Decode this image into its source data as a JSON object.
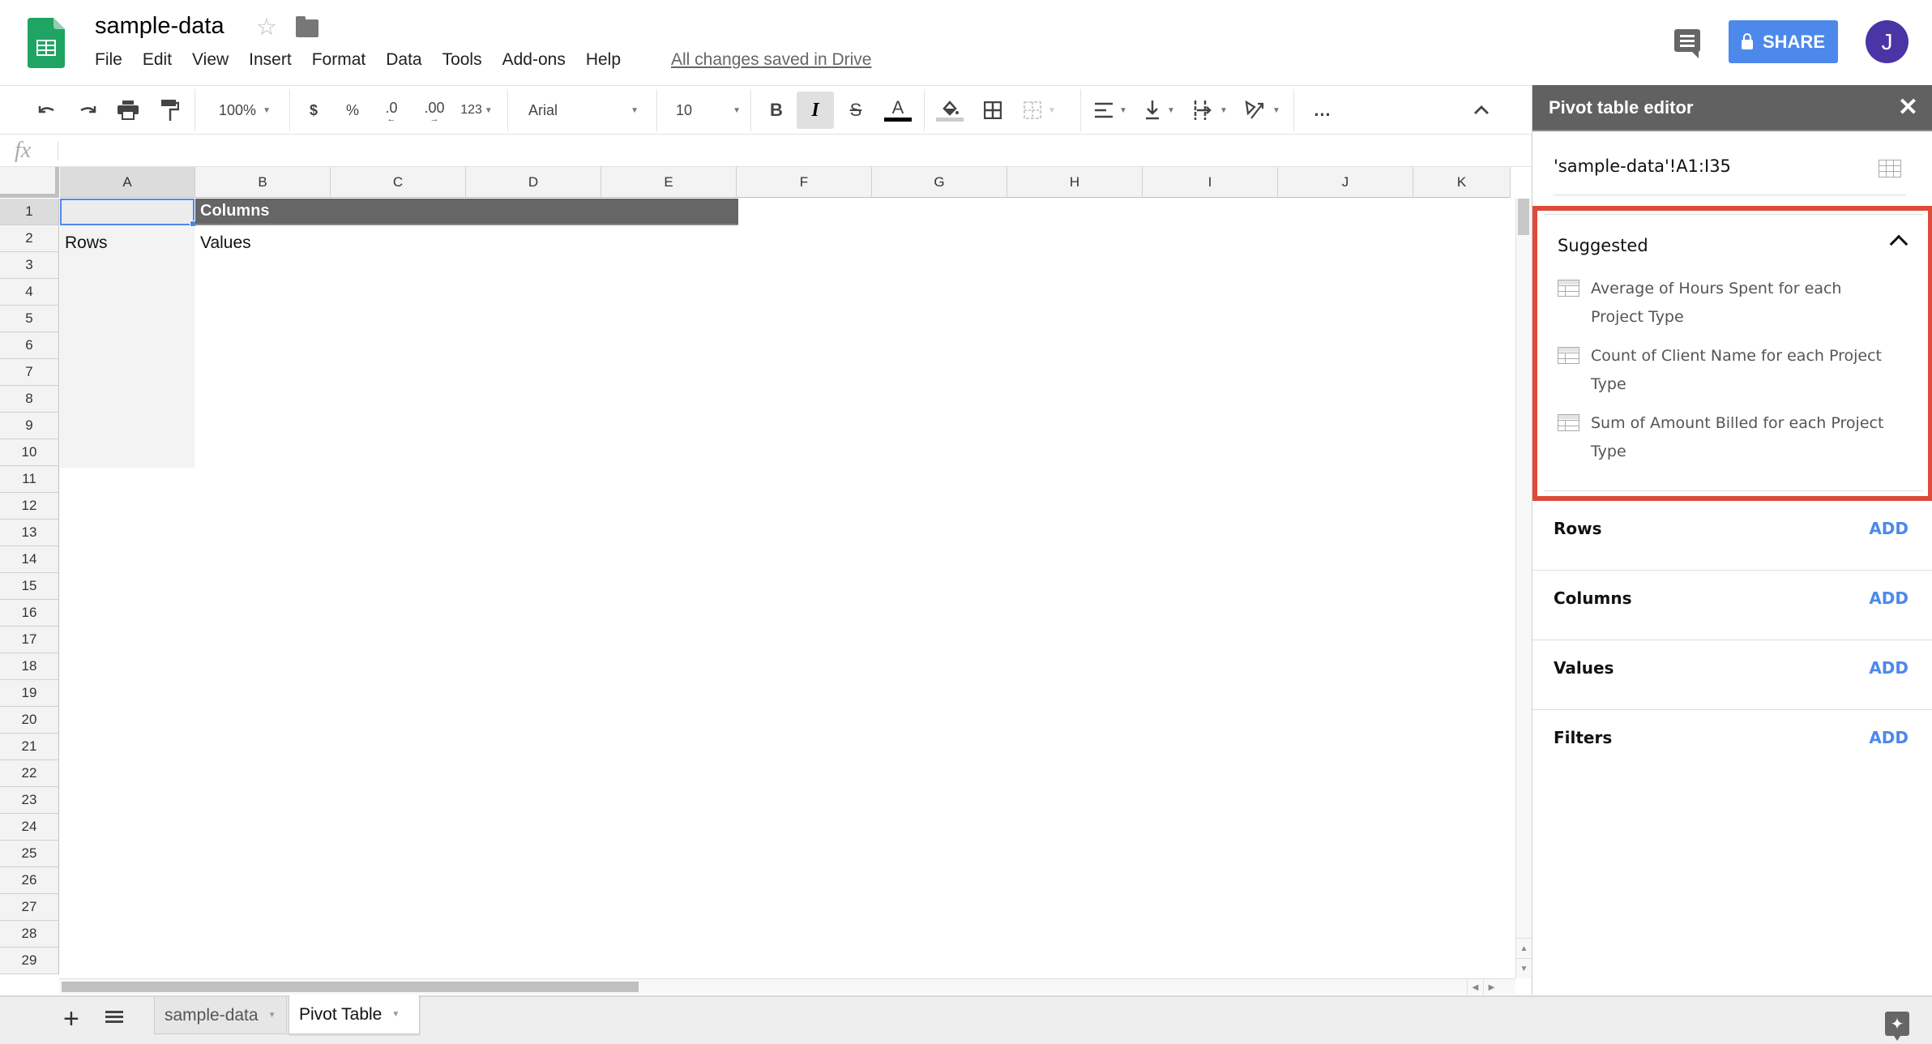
{
  "app": {
    "doc_title": "sample-data",
    "save_status": "All changes saved in Drive",
    "share_label": "SHARE",
    "avatar_initial": "J",
    "accent_color": "#4d89ea",
    "highlight_color": "#dd4b39"
  },
  "menu": [
    "File",
    "Edit",
    "View",
    "Insert",
    "Format",
    "Data",
    "Tools",
    "Add-ons",
    "Help"
  ],
  "toolbar": {
    "zoom": "100%",
    "currency": "$",
    "percent": "%",
    "decrease_decimal": ".0",
    "increase_decimal": ".00",
    "more_formats": "123",
    "font": "Arial",
    "font_size": "10",
    "bold": "B",
    "italic": "I",
    "strike": "S",
    "text_color": "A",
    "more": "…",
    "italic_active": true
  },
  "formula_bar": {
    "fx_label": "fx",
    "value": ""
  },
  "grid": {
    "columns": [
      "A",
      "B",
      "C",
      "D",
      "E",
      "F",
      "G",
      "H",
      "I",
      "J",
      "K"
    ],
    "rows": [
      "1",
      "2",
      "3",
      "4",
      "5",
      "6",
      "7",
      "8",
      "9",
      "10",
      "11",
      "12",
      "13",
      "14",
      "15",
      "16",
      "17",
      "18",
      "19",
      "20",
      "21",
      "22",
      "23",
      "24",
      "25",
      "26",
      "27",
      "28",
      "29"
    ],
    "selected_cell": "A1",
    "cells": {
      "B1": "Columns",
      "A2": "Rows",
      "B2": "Values"
    }
  },
  "sheets": {
    "tabs": [
      {
        "name": "sample-data",
        "active": false
      },
      {
        "name": "Pivot Table",
        "active": true
      }
    ]
  },
  "pivot_editor": {
    "title": "Pivot table editor",
    "range": "'sample-data'!A1:I35",
    "suggested": {
      "title": "Suggested",
      "items": [
        "Average of Hours Spent for each Project Type",
        "Count of Client Name for each Project Type",
        "Sum of Amount Billed for each Project Type"
      ]
    },
    "sections": [
      {
        "label": "Rows",
        "action": "ADD"
      },
      {
        "label": "Columns",
        "action": "ADD"
      },
      {
        "label": "Values",
        "action": "ADD"
      },
      {
        "label": "Filters",
        "action": "ADD"
      }
    ]
  }
}
